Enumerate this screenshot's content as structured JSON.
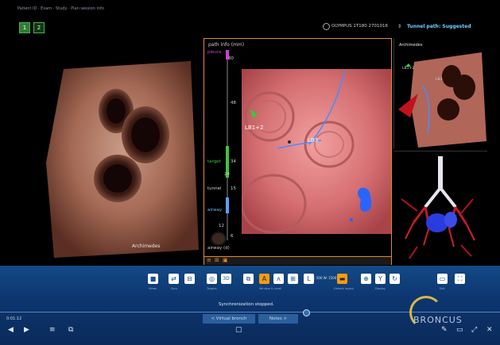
{
  "header": {
    "blurred_text": "Patient ID · Exam · Study · Plan session info",
    "view_buttons": [
      "1",
      "2"
    ],
    "scope_model": "OLYMPUS 1T180 2701016",
    "tunnel_path_label": "Tunnel path: Suggested"
  },
  "left_view": {
    "watermark": "Archimedes"
  },
  "center_panel": {
    "path_info_title": "path info (mm)",
    "scale_labels": {
      "pleura": "pleura",
      "v80": "80",
      "v48": "48",
      "v34": "34",
      "v24": "24",
      "target": "target",
      "v15": "15",
      "tunnel": "tunnel",
      "airway": "airway",
      "v12": "12",
      "v6": "6",
      "airway_d": "airway (d)"
    },
    "airway_labels": [
      "LB1+2",
      "LB3"
    ],
    "bottom_tabs": [
      "≡",
      "⊞",
      "▣"
    ]
  },
  "right_top": {
    "watermark": "Archimedes",
    "labels": [
      "LB3",
      "LB1+2"
    ]
  },
  "toolbar": {
    "icons": [
      {
        "name": "stop-icon",
        "glyph": "■",
        "label": "Views"
      },
      {
        "name": "sync-icon",
        "glyph": "⇄",
        "label": "Sync"
      },
      {
        "name": "layout-icon",
        "glyph": "⊟",
        "label": ""
      },
      {
        "name": "target-icon",
        "glyph": "◎",
        "label": "Targets"
      },
      {
        "name": "3d-icon",
        "glyph": "3D",
        "label": ""
      },
      {
        "name": "window-icon",
        "glyph": "⧉",
        "label": ""
      },
      {
        "name": "airway-icon",
        "glyph": "A",
        "label": "Window & Level"
      },
      {
        "name": "lung-icon",
        "glyph": "ᴧ",
        "label": ""
      },
      {
        "name": "zoom-icon",
        "glyph": "⊞",
        "label": ""
      },
      {
        "name": "level-icon",
        "glyph": "L",
        "label": "Level"
      },
      {
        "name": "layout-default-icon",
        "glyph": "▬",
        "label": "Default layout"
      },
      {
        "name": "crosshair-icon",
        "glyph": "⊕",
        "label": ""
      },
      {
        "name": "branch-icon",
        "glyph": "Y",
        "label": "Display"
      },
      {
        "name": "curve-icon",
        "glyph": "↻",
        "label": ""
      },
      {
        "name": "screen-icon",
        "glyph": "▭",
        "label": "Exit"
      },
      {
        "name": "fullscreen-icon",
        "glyph": "⛶",
        "label": ""
      }
    ],
    "level_value": "L: 500 W: 1500",
    "status": "Synchronization stopped.",
    "virtual_bronch": "< Virtual bronch",
    "notes": "Notes >",
    "time": "0:01:12",
    "brand": "BRONCUS",
    "bottom_icons": [
      "◀",
      "▶",
      "≡",
      "⧉",
      "▢",
      "✎",
      "▭",
      "⤢",
      "✕"
    ]
  },
  "colors": {
    "accent_orange": "#e08a2a",
    "magenta": "#d23bd2",
    "green": "#3ec43e",
    "toolbar_blue": "#0d3670"
  }
}
